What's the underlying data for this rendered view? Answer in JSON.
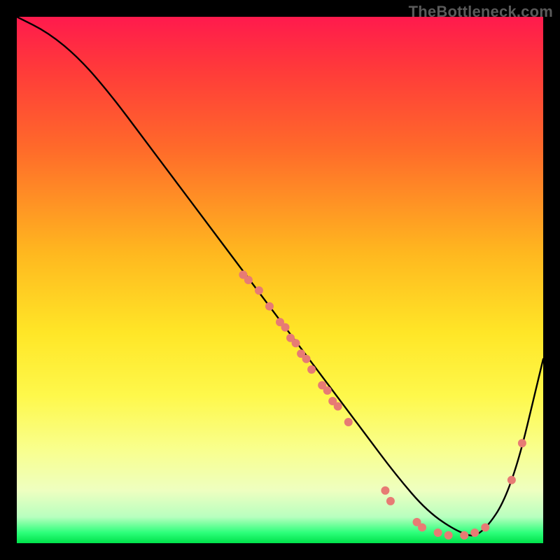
{
  "watermark": "TheBottleneck.com",
  "chart_data": {
    "type": "line",
    "title": "",
    "xlabel": "",
    "ylabel": "",
    "xlim": [
      0,
      100
    ],
    "ylim": [
      0,
      100
    ],
    "curve": {
      "x": [
        0,
        6,
        12,
        18,
        24,
        30,
        36,
        42,
        48,
        54,
        60,
        66,
        72,
        78,
        84,
        88,
        94,
        100
      ],
      "y": [
        100,
        97,
        92,
        85,
        77,
        69,
        61,
        53,
        45,
        37,
        29,
        21,
        13,
        6,
        2,
        1,
        10,
        35
      ]
    },
    "marker_groups": [
      {
        "name": "cluster-a",
        "color": "#e77b74",
        "radius_px": 6,
        "points": [
          {
            "x": 43,
            "y": 51
          },
          {
            "x": 44,
            "y": 50
          },
          {
            "x": 46,
            "y": 48
          },
          {
            "x": 48,
            "y": 45
          },
          {
            "x": 50,
            "y": 42
          },
          {
            "x": 51,
            "y": 41
          },
          {
            "x": 52,
            "y": 39
          },
          {
            "x": 53,
            "y": 38
          },
          {
            "x": 54,
            "y": 36
          },
          {
            "x": 55,
            "y": 35
          },
          {
            "x": 56,
            "y": 33
          },
          {
            "x": 58,
            "y": 30
          },
          {
            "x": 59,
            "y": 29
          },
          {
            "x": 60,
            "y": 27
          },
          {
            "x": 61,
            "y": 26
          },
          {
            "x": 63,
            "y": 23
          }
        ]
      },
      {
        "name": "cluster-b",
        "color": "#e77b74",
        "radius_px": 6,
        "points": [
          {
            "x": 70,
            "y": 10
          },
          {
            "x": 71,
            "y": 8
          },
          {
            "x": 76,
            "y": 4
          },
          {
            "x": 77,
            "y": 3
          },
          {
            "x": 80,
            "y": 2
          },
          {
            "x": 82,
            "y": 1.5
          },
          {
            "x": 85,
            "y": 1.5
          },
          {
            "x": 87,
            "y": 2
          },
          {
            "x": 89,
            "y": 3
          }
        ]
      },
      {
        "name": "cluster-c",
        "color": "#e77b74",
        "radius_px": 6,
        "points": [
          {
            "x": 94,
            "y": 12
          },
          {
            "x": 96,
            "y": 19
          }
        ]
      }
    ]
  }
}
